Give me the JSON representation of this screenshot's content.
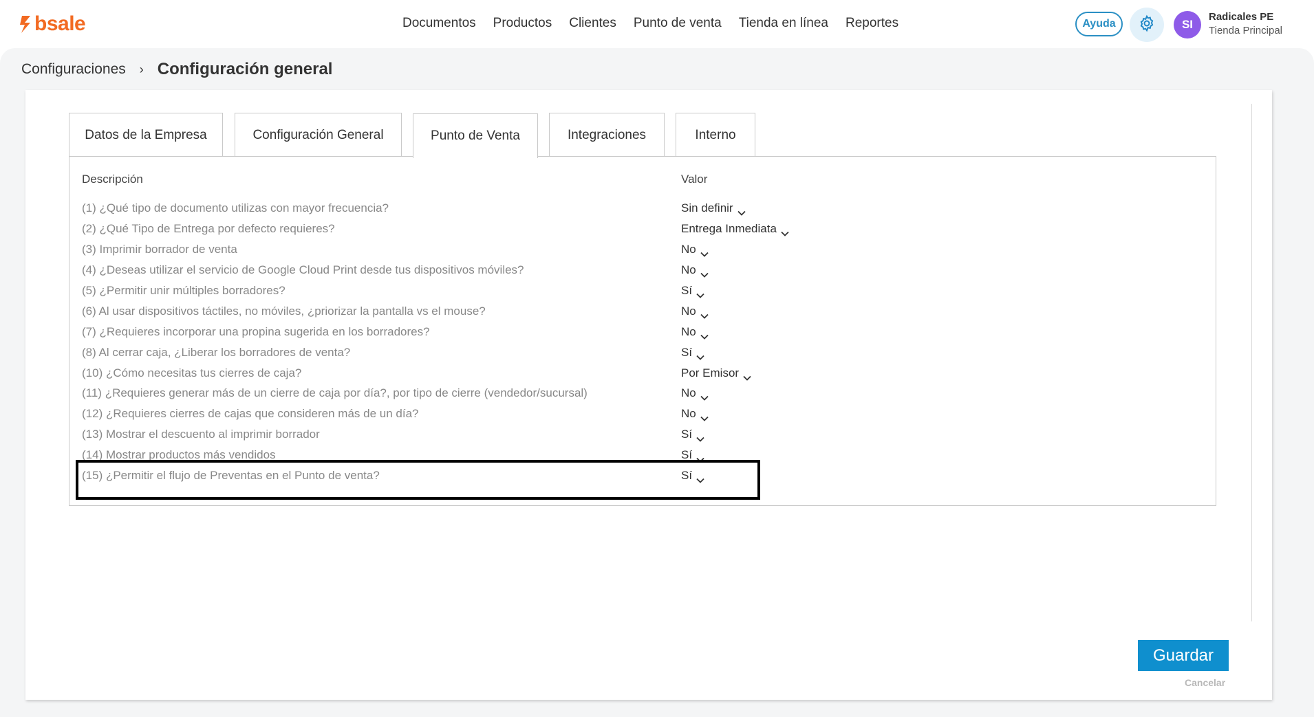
{
  "brand": {
    "name": "bsale",
    "color": "#f26a22"
  },
  "nav": {
    "items": [
      "Documentos",
      "Productos",
      "Clientes",
      "Punto de venta",
      "Tienda en línea",
      "Reportes"
    ]
  },
  "header": {
    "help_label": "Ayuda",
    "settings_icon": "gear-icon",
    "avatar_initials": "SI",
    "user_name": "Radicales PE",
    "store_name": "Tienda Principal"
  },
  "breadcrumb": {
    "parent": "Configuraciones",
    "separator": "›",
    "current": "Configuración general"
  },
  "tabs": [
    {
      "label": "Datos de la Empresa",
      "active": false
    },
    {
      "label": "Configuración General",
      "active": false
    },
    {
      "label": "Punto de Venta",
      "active": true
    },
    {
      "label": "Integraciones",
      "active": false
    },
    {
      "label": "Interno",
      "active": false
    }
  ],
  "table": {
    "headers": {
      "description": "Descripción",
      "value": "Valor"
    },
    "rows": [
      {
        "description": "(1) ¿Qué tipo de documento utilizas con mayor frecuencia?",
        "value": "Sin definir"
      },
      {
        "description": "(2) ¿Qué Tipo de Entrega por defecto requieres?",
        "value": "Entrega Inmediata"
      },
      {
        "description": "(3) Imprimir borrador de venta",
        "value": "No"
      },
      {
        "description": "(4) ¿Deseas utilizar el servicio de Google Cloud Print desde tus dispositivos móviles?",
        "value": "No"
      },
      {
        "description": "(5) ¿Permitir unir múltiples borradores?",
        "value": "Sí"
      },
      {
        "description": "(6) Al usar dispositivos táctiles, no móviles, ¿priorizar la pantalla vs el mouse?",
        "value": "No"
      },
      {
        "description": "(7) ¿Requieres incorporar una propina sugerida en los borradores?",
        "value": "No"
      },
      {
        "description": "(8) Al cerrar caja, ¿Liberar los borradores de venta?",
        "value": "Sí"
      },
      {
        "description": "(10) ¿Cómo necesitas tus cierres de caja?",
        "value": "Por Emisor"
      },
      {
        "description": "(11) ¿Requieres generar más de un cierre de caja por día?, por tipo de cierre (vendedor/sucursal)",
        "value": "No"
      },
      {
        "description": "(12) ¿Requieres cierres de cajas que consideren más de un día?",
        "value": "No"
      },
      {
        "description": "(13) Mostrar el descuento al imprimir borrador",
        "value": "Sí"
      },
      {
        "description": "(14) Mostrar productos más vendidos",
        "value": "Sí"
      },
      {
        "description": "(15) ¿Permitir el flujo de Preventas en el Punto de venta?",
        "value": "Sí"
      }
    ]
  },
  "actions": {
    "save_label": "Guardar",
    "cancel_label": "Cancelar",
    "save_color": "#0f8fce"
  }
}
